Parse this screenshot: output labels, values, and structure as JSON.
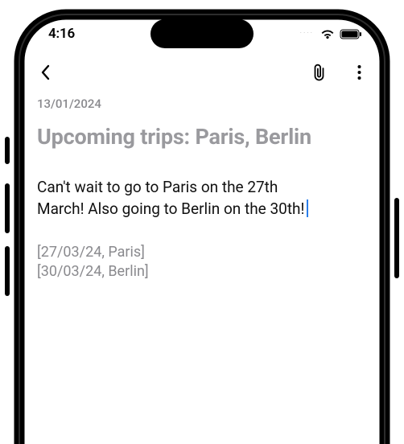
{
  "status_bar": {
    "time": "4:16",
    "signal_dots": "····"
  },
  "nav": {
    "back": "Back",
    "attach": "Attach",
    "more": "More options"
  },
  "note": {
    "date": "13/01/2024",
    "title": "Upcoming trips: Paris, Berlin",
    "body_line1": "Can't wait to go to Paris on the 27th",
    "body_line2": "March! Also going to Berlin on the 30th!",
    "extracted": [
      "[27/03/24, Paris]",
      "[30/03/24, Berlin]"
    ]
  }
}
